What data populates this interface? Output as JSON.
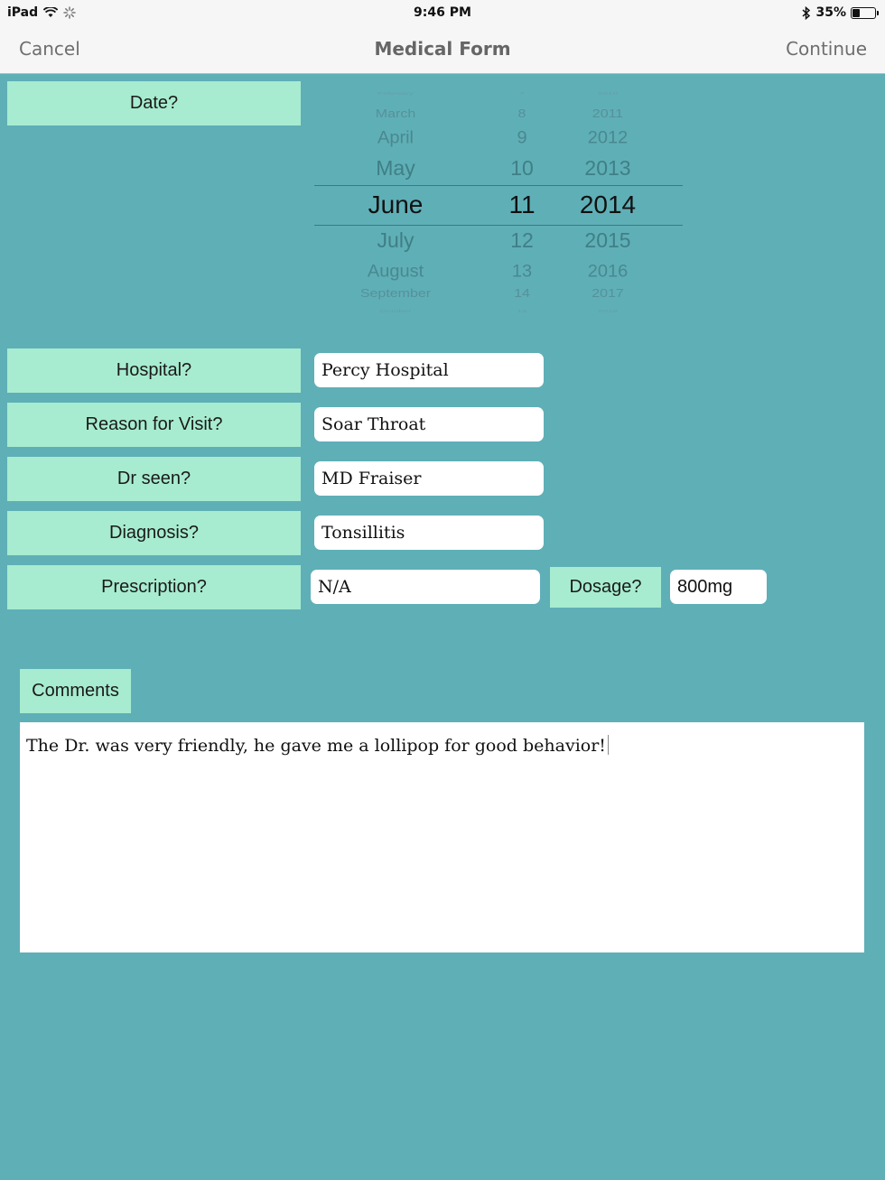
{
  "status_bar": {
    "device": "iPad",
    "time": "9:46 PM",
    "battery": "35%",
    "battery_level": 0.35
  },
  "nav": {
    "cancel": "Cancel",
    "title": "Medical Form",
    "continue": "Continue"
  },
  "date": {
    "label": "Date?",
    "picker": {
      "rows": [
        {
          "month": "February",
          "day": "7",
          "year": "2010"
        },
        {
          "month": "March",
          "day": "8",
          "year": "2011"
        },
        {
          "month": "April",
          "day": "9",
          "year": "2012"
        },
        {
          "month": "May",
          "day": "10",
          "year": "2013"
        },
        {
          "month": "June",
          "day": "11",
          "year": "2014"
        },
        {
          "month": "July",
          "day": "12",
          "year": "2015"
        },
        {
          "month": "August",
          "day": "13",
          "year": "2016"
        },
        {
          "month": "September",
          "day": "14",
          "year": "2017"
        },
        {
          "month": "October",
          "day": "15",
          "year": "2018"
        }
      ],
      "selected_index": 4
    }
  },
  "form": {
    "hospital": {
      "label": "Hospital?",
      "value": "Percy Hospital"
    },
    "reason": {
      "label": "Reason for Visit?",
      "value": "Soar Throat"
    },
    "doctor": {
      "label": "Dr seen?",
      "value": "MD Fraiser"
    },
    "diagnosis": {
      "label": "Diagnosis?",
      "value": "Tonsillitis"
    },
    "prescription": {
      "label": "Prescription?",
      "value": "N/A"
    },
    "dosage": {
      "label": "Dosage?",
      "value": "800mg"
    }
  },
  "comments": {
    "label": "Comments",
    "value": "The Dr. was very friendly, he gave me a lollipop for good behavior!"
  },
  "colors": {
    "background": "#5fafb7",
    "label_bg": "#a7ecd0",
    "field_bg": "#ffffff"
  }
}
